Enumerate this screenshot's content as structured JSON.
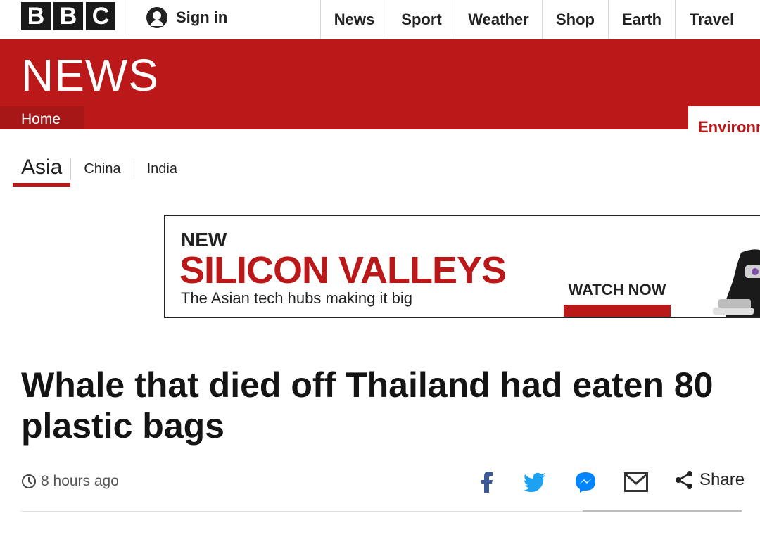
{
  "brand": {
    "logo_letters": [
      "B",
      "B",
      "C"
    ],
    "accent_color": "#bb1919"
  },
  "header": {
    "signin_label": "Sign in",
    "nav": [
      "News",
      "Sport",
      "Weather",
      "Shop",
      "Earth",
      "Travel"
    ]
  },
  "news_header": {
    "title": "NEWS",
    "home_label": "Home",
    "partial_tab_label": "Environmen"
  },
  "sections": {
    "active": "Asia",
    "items": [
      "China",
      "India"
    ]
  },
  "promo": {
    "kicker": "NEW",
    "title": "SILICON VALLEYS",
    "subtitle": "The Asian tech hubs making it big",
    "cta": "WATCH NOW"
  },
  "article": {
    "headline": "Whale that died off Thailand had eaten 80 plastic bags",
    "timestamp": "8 hours ago"
  },
  "share": {
    "icons": [
      "facebook-icon",
      "twitter-icon",
      "messenger-icon",
      "email-icon"
    ],
    "label": "Share"
  }
}
